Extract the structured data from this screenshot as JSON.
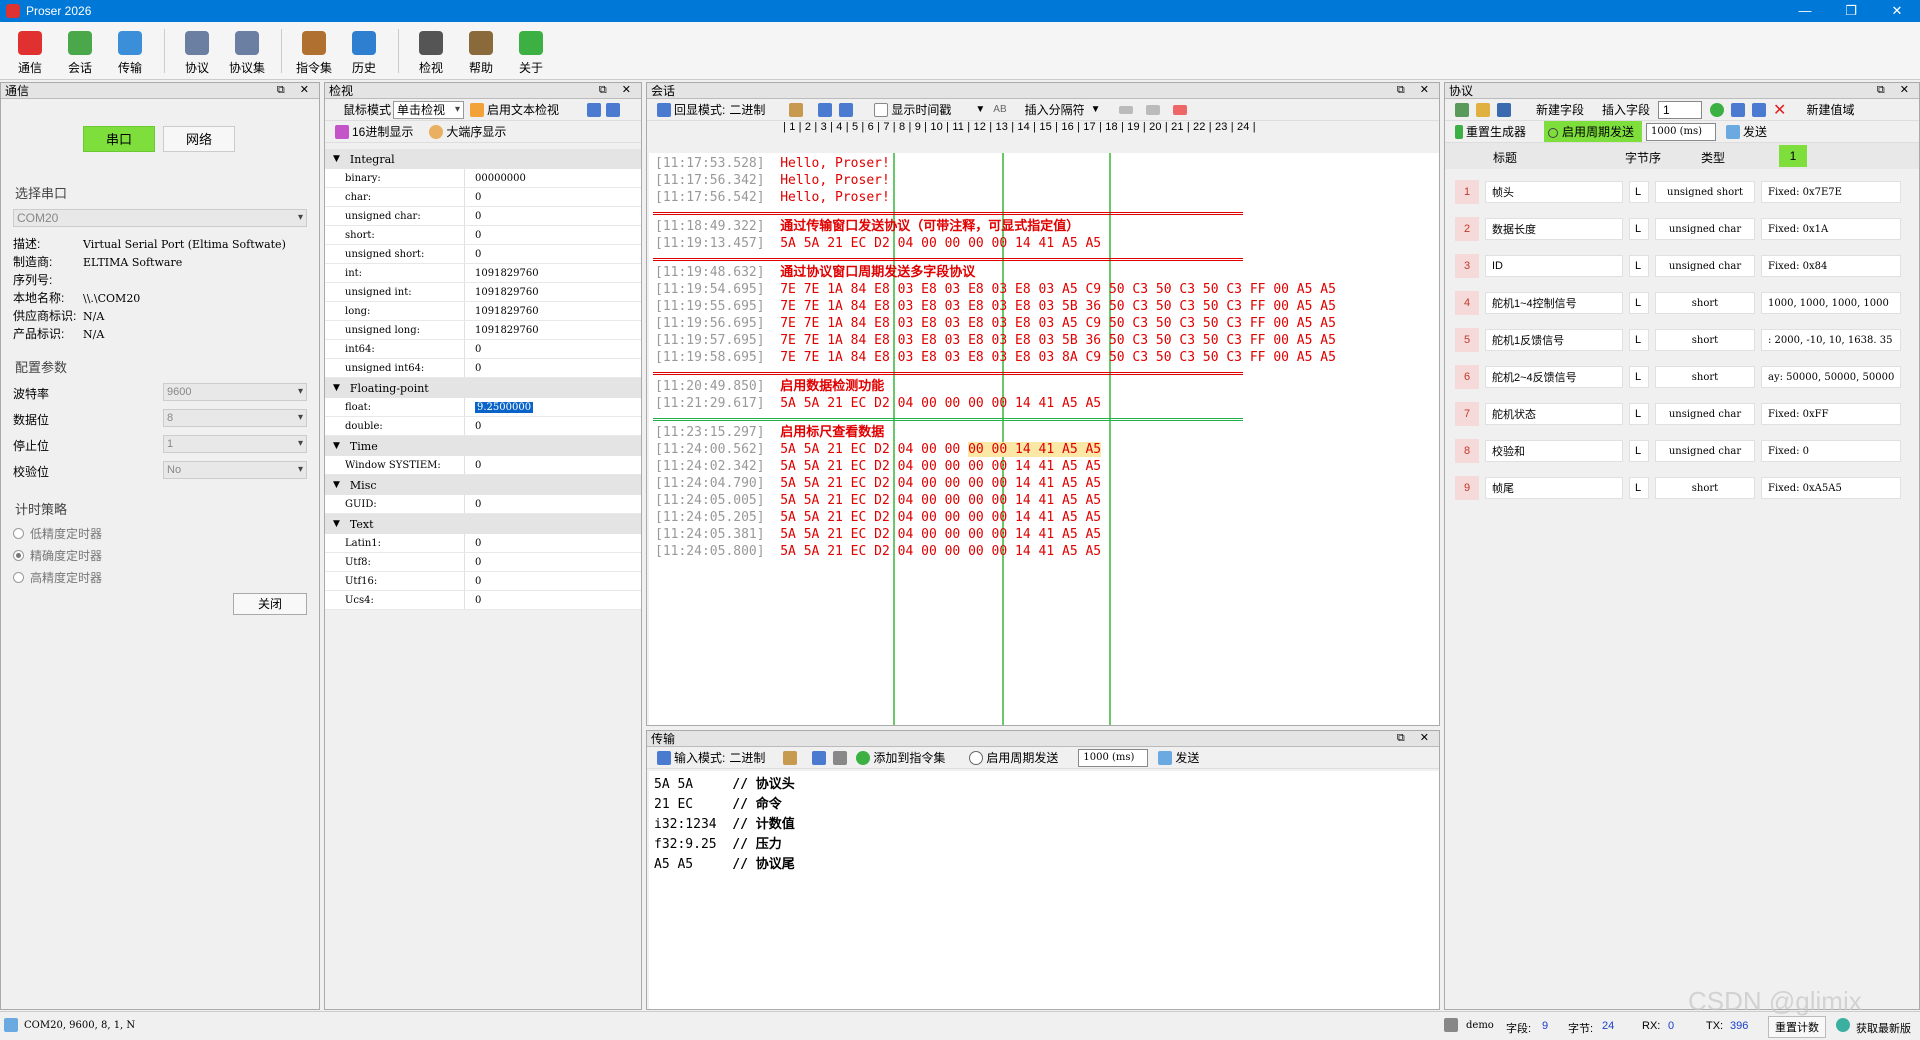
{
  "window": {
    "title": "Proser 2026"
  },
  "toolbar": [
    {
      "label": "通信",
      "icon": "phone-icon",
      "color": "#e03030"
    },
    {
      "label": "会话",
      "icon": "chat-icon",
      "color": "#4aa84a"
    },
    {
      "label": "传输",
      "icon": "transfer-icon",
      "color": "#3a8fd8"
    },
    {
      "label": "协议",
      "icon": "protocol-icon",
      "color": "#6b7fa3"
    },
    {
      "label": "协议集",
      "icon": "protocol-set-icon",
      "color": "#6b7fa3"
    },
    {
      "label": "指令集",
      "icon": "command-set-icon",
      "color": "#b07030"
    },
    {
      "label": "历史",
      "icon": "history-icon",
      "color": "#2f7fd0"
    },
    {
      "label": "检视",
      "icon": "inspect-icon",
      "color": "#555555"
    },
    {
      "label": "帮助",
      "icon": "help-icon",
      "color": "#8a6a3a"
    },
    {
      "label": "关于",
      "icon": "about-icon",
      "color": "#3cb043"
    }
  ],
  "comm": {
    "title": "通信",
    "tab_serial": "串口",
    "tab_network": "网络",
    "select_port_title": "选择串口",
    "port_value": "COM20",
    "info": [
      {
        "k": "描述:",
        "v": "Virtual Serial Port (Eltima Softwate)"
      },
      {
        "k": "制造商:",
        "v": "ELTIMA Software"
      },
      {
        "k": "序列号:",
        "v": ""
      },
      {
        "k": "本地名称:",
        "v": "\\\\.\\COM20"
      },
      {
        "k": "供应商标识:",
        "v": "N/A"
      },
      {
        "k": "产品标识:",
        "v": "N/A"
      }
    ],
    "config_title": "配置参数",
    "config": [
      {
        "k": "波特率",
        "v": "9600"
      },
      {
        "k": "数据位",
        "v": "8"
      },
      {
        "k": "停止位",
        "v": "1"
      },
      {
        "k": "校验位",
        "v": "No"
      }
    ],
    "timer_title": "计时策略",
    "timers": [
      {
        "label": "低精度定时器",
        "on": false
      },
      {
        "label": "精确度定时器",
        "on": true
      },
      {
        "label": "高精度定时器",
        "on": false
      }
    ],
    "close_label": "关闭"
  },
  "inspect": {
    "title": "检视",
    "mouse_mode_label": "鼠标模式",
    "mouse_mode_value": "单击检视",
    "enable_text_label": "启用文本检视",
    "hex_label": "16进制显示",
    "big_endian_label": "大端序显示",
    "groups": [
      {
        "name": "Integral",
        "rows": [
          {
            "n": "binary:",
            "v": "00000000"
          },
          {
            "n": "char:",
            "v": "0"
          },
          {
            "n": "unsigned char:",
            "v": "0"
          },
          {
            "n": "short:",
            "v": "0"
          },
          {
            "n": "unsigned short:",
            "v": "0"
          },
          {
            "n": "int:",
            "v": "1091829760"
          },
          {
            "n": "unsigned int:",
            "v": "1091829760"
          },
          {
            "n": "long:",
            "v": "1091829760"
          },
          {
            "n": "unsigned long:",
            "v": "1091829760"
          },
          {
            "n": "int64:",
            "v": "0"
          },
          {
            "n": "unsigned int64:",
            "v": "0"
          }
        ]
      },
      {
        "name": "Floating-point",
        "rows": [
          {
            "n": "float:",
            "v": "9.2500000",
            "hl": true
          },
          {
            "n": "double:",
            "v": "0"
          }
        ]
      },
      {
        "name": "Time",
        "rows": [
          {
            "n": "Window SYSTIEM:",
            "v": "0"
          }
        ]
      },
      {
        "name": "Misc",
        "rows": [
          {
            "n": "GUID:",
            "v": "0"
          }
        ]
      },
      {
        "name": "Text",
        "rows": [
          {
            "n": "Latin1:",
            "v": "0"
          },
          {
            "n": "Utf8:",
            "v": "0"
          },
          {
            "n": "Utf16:",
            "v": "0"
          },
          {
            "n": "Ucs4:",
            "v": "0"
          }
        ]
      }
    ]
  },
  "session": {
    "title": "会话",
    "echo_mode_label": "回显模式:",
    "echo_mode_value": "二进制",
    "show_time_label": "显示时间戳",
    "insert_sep_label": "插入分隔符",
    "ruler": "| 1 | 2 | 3 | 4 | 5 | 6 | 7 | 8 | 9 | 10 | 11 | 12 | 13 | 14 | 15 | 16 | 17 | 18 | 19 | 20 | 21 | 22 | 23 | 24 |",
    "lines": [
      {
        "t": "[11:17:53.528]",
        "d": "Hello, Proser!"
      },
      {
        "t": "[11:17:56.342]",
        "d": "Hello, Proser!"
      },
      {
        "t": "[11:17:56.542]",
        "d": "Hello, Proser!"
      },
      {
        "sep": "red"
      },
      {
        "t": "[11:18:49.322]",
        "cap": "通过传输窗口发送协议（可带注释，可显式指定值）"
      },
      {
        "t": "[11:19:13.457]",
        "d": "5A 5A 21 EC D2 04 00 00 00 00 14 41 A5 A5"
      },
      {
        "sep": "red"
      },
      {
        "t": "[11:19:48.632]",
        "cap": "通过协议窗口周期发送多字段协议"
      },
      {
        "t": "[11:19:54.695]",
        "d": "7E 7E 1A 84 E8 03 E8 03 E8 03 E8 03 A5 C9 50 C3 50 C3 50 C3 FF 00 A5 A5"
      },
      {
        "t": "[11:19:55.695]",
        "d": "7E 7E 1A 84 E8 03 E8 03 E8 03 E8 03 5B 36 50 C3 50 C3 50 C3 FF 00 A5 A5"
      },
      {
        "t": "[11:19:56.695]",
        "d": "7E 7E 1A 84 E8 03 E8 03 E8 03 E8 03 A5 C9 50 C3 50 C3 50 C3 FF 00 A5 A5"
      },
      {
        "t": "[11:19:57.695]",
        "d": "7E 7E 1A 84 E8 03 E8 03 E8 03 E8 03 5B 36 50 C3 50 C3 50 C3 FF 00 A5 A5"
      },
      {
        "t": "[11:19:58.695]",
        "d": "7E 7E 1A 84 E8 03 E8 03 E8 03 E8 03 8A C9 50 C3 50 C3 50 C3 FF 00 A5 A5"
      },
      {
        "sep": "red"
      },
      {
        "t": "[11:20:49.850]",
        "cap": "启用数据检测功能"
      },
      {
        "t": "[11:21:29.617]",
        "d": "5A 5A 21 EC D2 04 00 00 00 00 14 41 A5 A5"
      },
      {
        "sep": "green"
      },
      {
        "t": "[11:23:15.297]",
        "cap": "启用标尺查看数据"
      },
      {
        "t": "[11:24:00.562]",
        "d": "5A 5A 21 EC D2 04 00 00 ",
        "h": "00 00 14 41 A5 A5"
      },
      {
        "t": "[11:24:02.342]",
        "d": "5A 5A 21 EC D2 04 00 00 00 00 14 41 A5 A5"
      },
      {
        "t": "[11:24:04.790]",
        "d": "5A 5A 21 EC D2 04 00 00 00 00 14 41 A5 A5"
      },
      {
        "t": "[11:24:05.005]",
        "d": "5A 5A 21 EC D2 04 00 00 00 00 14 41 A5 A5"
      },
      {
        "t": "[11:24:05.205]",
        "d": "5A 5A 21 EC D2 04 00 00 00 00 14 41 A5 A5"
      },
      {
        "t": "[11:24:05.381]",
        "d": "5A 5A 21 EC D2 04 00 00 00 00 14 41 A5 A5"
      },
      {
        "t": "[11:24:05.800]",
        "d": "5A 5A 21 EC D2 04 00 00 00 00 14 41 A5 A5"
      }
    ]
  },
  "transmit": {
    "title": "传输",
    "input_mode_label": "输入模式:",
    "input_mode_value": "二进制",
    "add_cmd_label": "添加到指令集",
    "periodic_label": "启用周期发送",
    "period_value": "1000 (ms)",
    "send_label": "发送",
    "lines": [
      {
        "code": "5A 5A     ",
        "comment": "// 协议头"
      },
      {
        "code": "21 EC     ",
        "comment": "// 命令"
      },
      {
        "code": "i32:1234  ",
        "comment": "// 计数值"
      },
      {
        "code": "f32:9.25  ",
        "comment": "// 压力"
      },
      {
        "code": "A5 A5     ",
        "comment": "// 协议尾"
      }
    ]
  },
  "protocol": {
    "title": "协议",
    "new_field": "新建字段",
    "insert_field": "插入字段",
    "insert_value": "1",
    "new_value_field": "新建值域",
    "reset_generator": "重置生成器",
    "periodic_label": "启用周期发送",
    "period_value": "1000 (ms)",
    "send_label": "发送",
    "col_title": "标题",
    "col_endian": "字节序",
    "col_type": "类型",
    "col_badge": "1",
    "rows": [
      {
        "n": "1",
        "title": "帧头",
        "e": "L",
        "type": "unsigned short",
        "val": "Fixed: 0x7E7E"
      },
      {
        "n": "2",
        "title": "数据长度",
        "e": "L",
        "type": "unsigned char",
        "val": "Fixed: 0x1A"
      },
      {
        "n": "3",
        "title": "ID",
        "e": "L",
        "type": "unsigned char",
        "val": "Fixed: 0x84"
      },
      {
        "n": "4",
        "title": "舵机1~4控制信号",
        "e": "L",
        "type": "short",
        "val": "1000, 1000, 1000, 1000"
      },
      {
        "n": "5",
        "title": "舵机1反馈信号",
        "e": "L",
        "type": "short",
        "val": ": 2000, -10, 10, 1638. 35"
      },
      {
        "n": "6",
        "title": "舵机2~4反馈信号",
        "e": "L",
        "type": "short",
        "val": "ay: 50000, 50000, 50000"
      },
      {
        "n": "7",
        "title": "舵机状态",
        "e": "L",
        "type": "unsigned char",
        "val": "Fixed: 0xFF"
      },
      {
        "n": "8",
        "title": "校验和",
        "e": "L",
        "type": "unsigned char",
        "val": "Fixed: 0"
      },
      {
        "n": "9",
        "title": "帧尾",
        "e": "L",
        "type": "short",
        "val": "Fixed: 0xA5A5"
      }
    ]
  },
  "status": {
    "port_info": "COM20, 9600, 8, 1, N",
    "proto_name": "demo",
    "field_label": "字段:",
    "field_value": "9",
    "byte_label": "字节:",
    "byte_value": "24",
    "rx_label": "RX:",
    "rx_value": "0",
    "tx_label": "TX:",
    "tx_value": "396",
    "reset_count": "重置计数",
    "fetch_latest": "获取最新版",
    "watermark": "CSDN @glimix"
  }
}
